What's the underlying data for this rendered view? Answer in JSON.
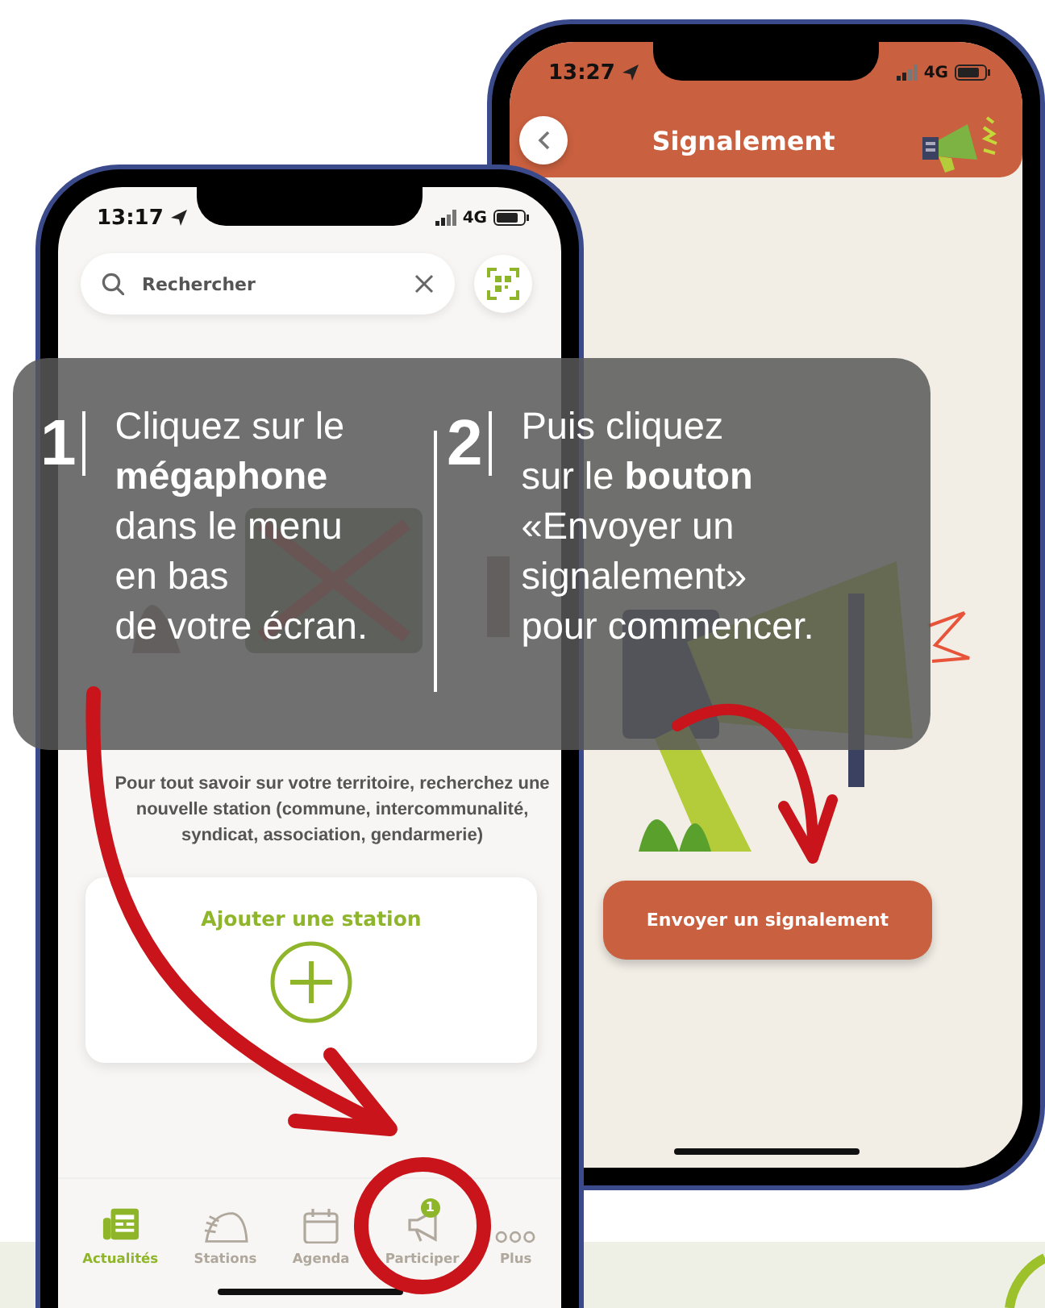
{
  "back_phone": {
    "status": {
      "time": "13:27",
      "network": "4G"
    },
    "title": "Signalement",
    "button": "Envoyer un signalement"
  },
  "front_phone": {
    "status": {
      "time": "13:17",
      "network": "4G"
    },
    "search": {
      "placeholder": "Rechercher"
    },
    "message": "Pour tout savoir sur votre territoire, recherchez une nouvelle station (commune, intercommunalité, syndicat, association, gendarmerie)",
    "card_title": "Ajouter une station",
    "tabs": [
      {
        "label": "Actualités",
        "kind": "news",
        "selected": true
      },
      {
        "label": "Stations",
        "kind": "stations",
        "selected": false
      },
      {
        "label": "Agenda",
        "kind": "agenda",
        "selected": false
      },
      {
        "label": "Participer",
        "kind": "megaphone",
        "selected": false,
        "badge": "1"
      },
      {
        "label": "Plus",
        "kind": "more",
        "selected": false
      }
    ]
  },
  "overlay": {
    "steps": [
      {
        "number": "1",
        "lines": [
          "Cliquez sur le",
          "**mégaphone**",
          "dans le menu",
          "en bas",
          "de votre écran."
        ]
      },
      {
        "number": "2",
        "lines": [
          "Puis cliquez",
          "sur le **bouton**",
          "«Envoyer un",
          "signalement»",
          "pour commencer."
        ]
      }
    ]
  }
}
